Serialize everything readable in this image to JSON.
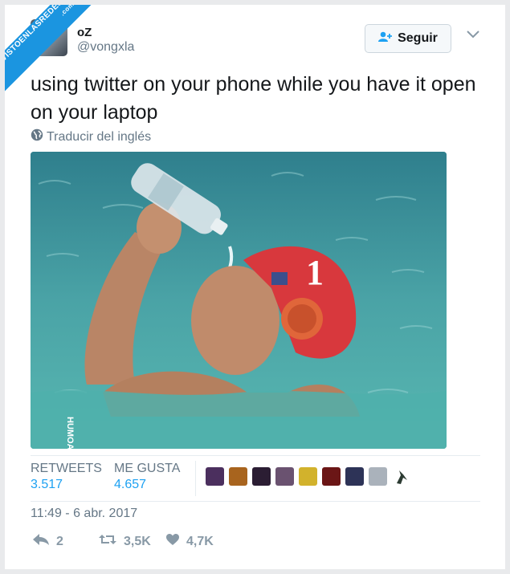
{
  "watermark": {
    "brand": "VISTOENLASREDES",
    "domain": ".com"
  },
  "user": {
    "name": "oZ",
    "handle": "@vongxla"
  },
  "follow_button": {
    "label": "Seguir",
    "icon": "add-user-icon"
  },
  "tweet": {
    "text": "using twitter on your phone while you have it open on your laptop"
  },
  "translate": {
    "label": "Traducir del inglés",
    "icon": "globe-icon"
  },
  "media": {
    "description_icon": "photo-water-polo-player",
    "watermark": "HUMOA"
  },
  "stats": {
    "retweets_label": "RETWEETS",
    "retweets_value": "3.517",
    "likes_label": "ME GUSTA",
    "likes_value": "4.657",
    "liker_avatars": 9
  },
  "timestamp": "11:49 - 6 abr. 2017",
  "actions": {
    "reply_count": "2",
    "retweet_count": "3,5K",
    "like_count": "4,7K"
  },
  "colors": {
    "accent": "#1da1f2",
    "muted": "#657786",
    "brand_ribbon": "#1b95e0"
  }
}
